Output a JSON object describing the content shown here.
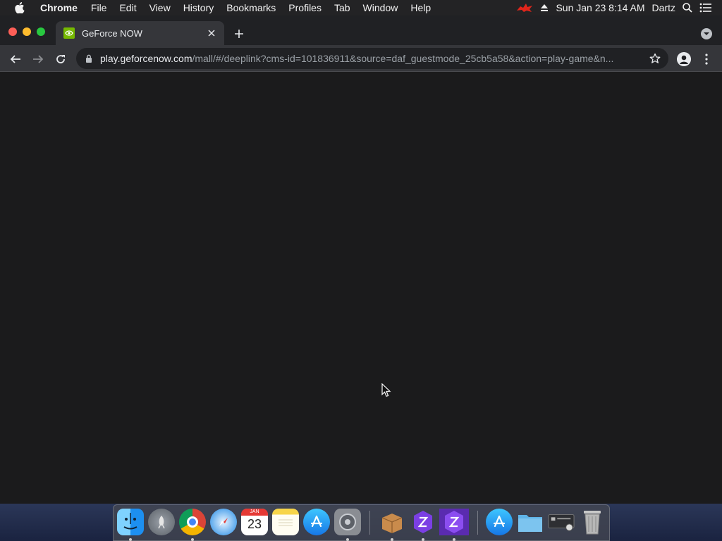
{
  "menubar": {
    "app_name": "Chrome",
    "items": [
      "File",
      "Edit",
      "View",
      "History",
      "Bookmarks",
      "Profiles",
      "Tab",
      "Window",
      "Help"
    ],
    "datetime": "Sun Jan 23  8:14 AM",
    "user": "Dartz"
  },
  "browser": {
    "tab_title": "GeForce NOW",
    "url_host": "play.geforcenow.com",
    "url_path": "/mall/#/deeplink?cms-id=101836911&source=daf_guestmode_25cb5a58&action=play-game&n..."
  },
  "dock": {
    "calendar_month": "JAN",
    "calendar_day": "23",
    "apps": [
      "finder-icon",
      "launchpad-icon",
      "chrome-icon",
      "safari-icon",
      "calendar-icon",
      "notes-icon",
      "app-store-icon",
      "system-preferences-icon",
      "installer-icon",
      "flight-app-icon",
      "flight-app-icon-active",
      "app-store-downloads-icon",
      "folder-icon",
      "screenshot-icon",
      "trash-icon"
    ]
  },
  "colors": {
    "content_background": "#1b1b1c",
    "nvidia_green": "#76b900",
    "toolbar": "#35363a"
  }
}
